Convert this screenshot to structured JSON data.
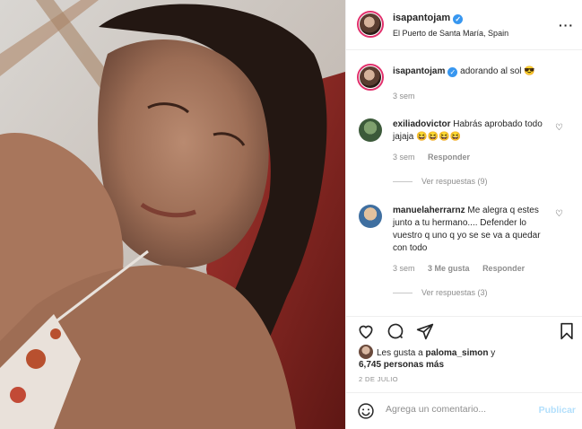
{
  "post": {
    "username": "isapantojam",
    "location": "El Puerto de Santa María, Spain",
    "more_icon": "more-dots-icon",
    "caption_text": "adorando al sol",
    "caption_emoji": "😎",
    "caption_time": "3 sem"
  },
  "comments": [
    {
      "username": "exiliadovictor",
      "text": "Habrás aprobado todo jajaja 😆😆😆😆",
      "time": "3 sem",
      "likes": "",
      "reply_label": "Responder",
      "view_replies": "Ver respuestas (9)"
    },
    {
      "username": "manuelaherrarnz",
      "text": "Me alegra q estes junto a tu hermano.... Defender lo vuestro q uno q yo se se va a quedar con todo",
      "time": "3 sem",
      "likes": "3 Me gusta",
      "reply_label": "Responder",
      "view_replies": "Ver respuestas (3)"
    }
  ],
  "likes": {
    "prefix": "Les gusta a ",
    "user": "paloma_simon",
    "connector": " y",
    "count": "6,745 personas más"
  },
  "date": "2 DE JULIO",
  "add_comment": {
    "placeholder": "Agrega un comentario...",
    "post_label": "Publicar"
  },
  "icons": {
    "like": "heart-icon",
    "comment": "comment-icon",
    "share": "share-icon",
    "save": "bookmark-icon",
    "emoji": "emoji-icon"
  },
  "colors": {
    "verified": "#3897f0",
    "muted": "#8e8e8e",
    "post_disabled": "#b2dffc"
  }
}
